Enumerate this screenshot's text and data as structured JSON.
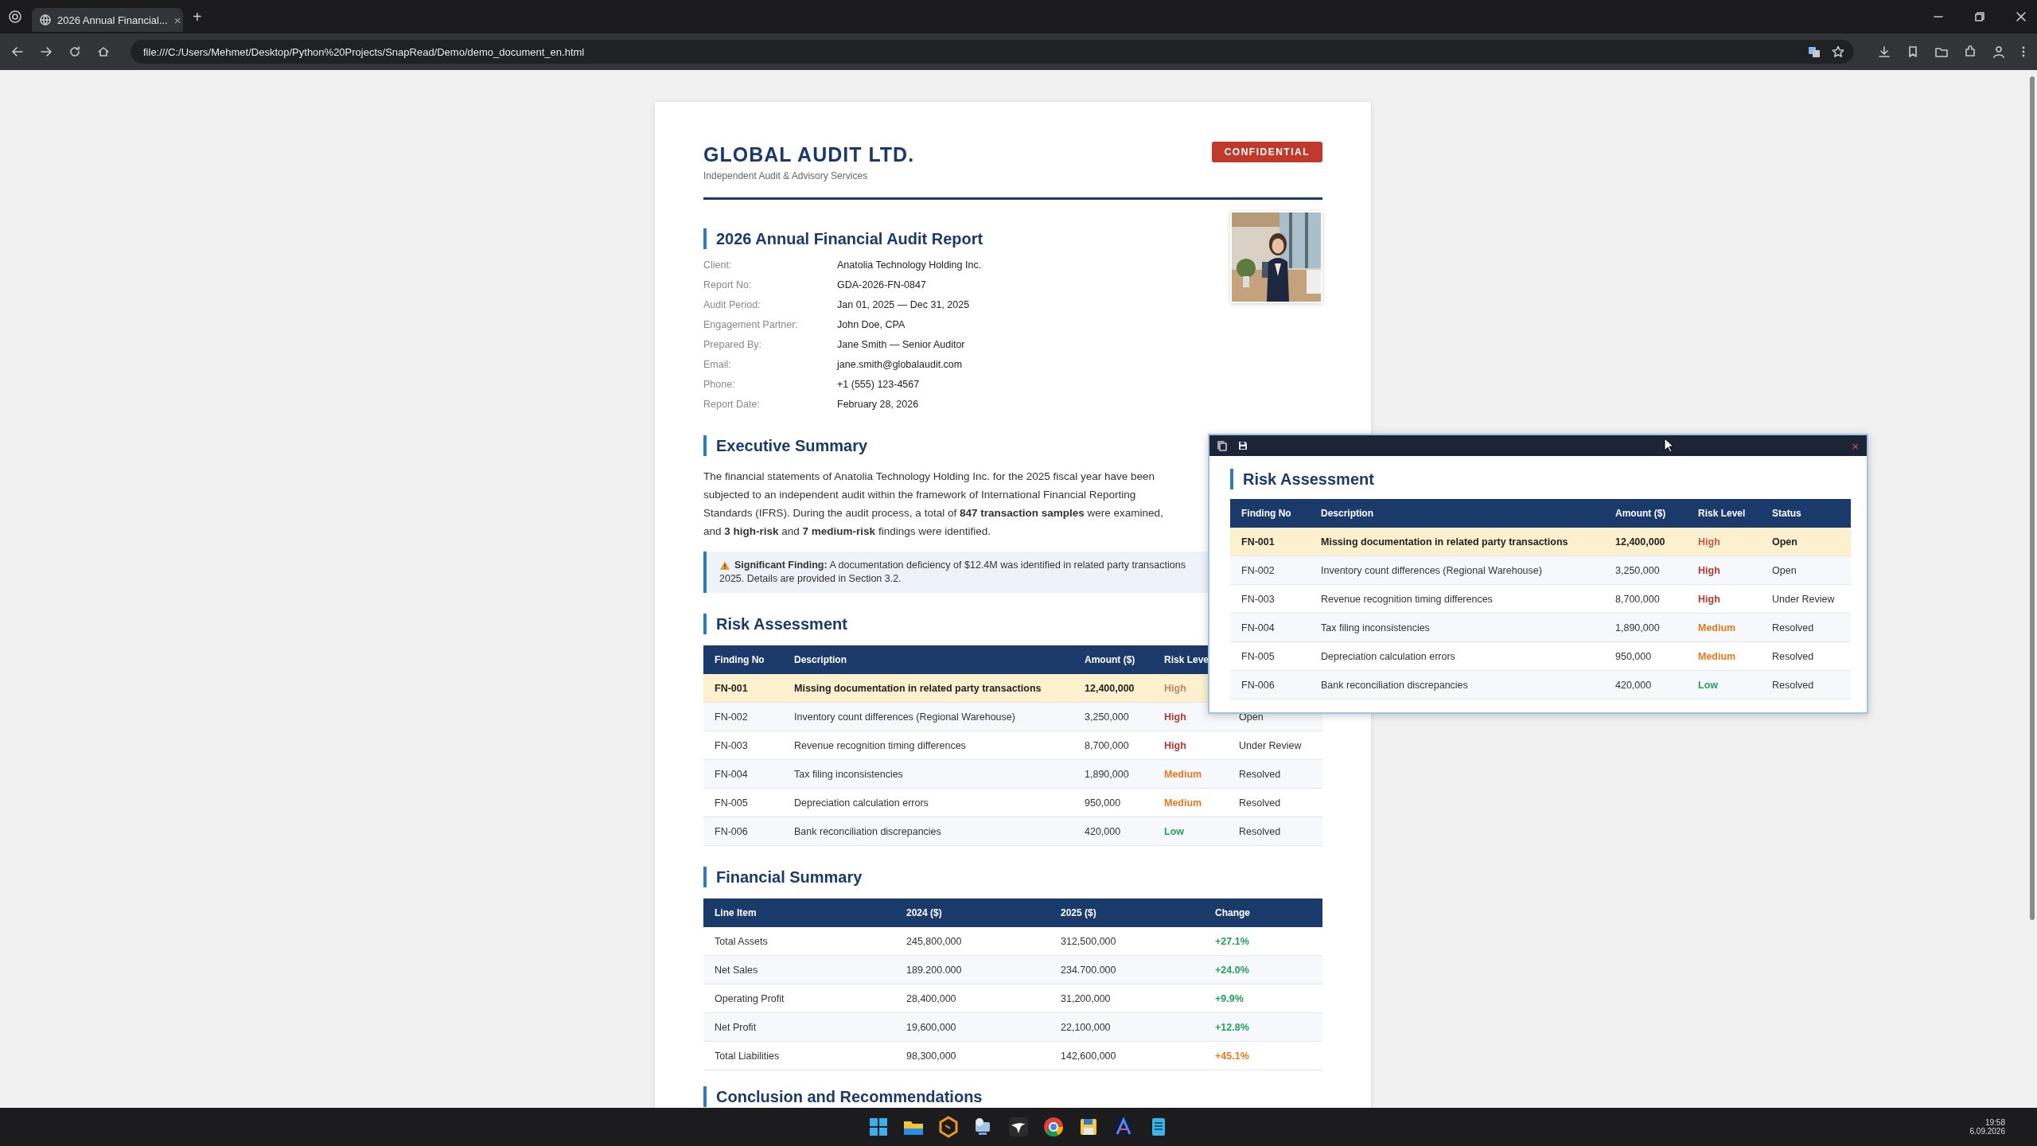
{
  "browser": {
    "tab_title": "2026 Annual Financial...",
    "new_tab": "+",
    "tab_close": "×",
    "url": "file:///C:/Users/Mehmet/Desktop/Python%20Projects/SnapRead/Demo/demo_document_en.html"
  },
  "document": {
    "company": "GLOBAL AUDIT LTD.",
    "tagline": "Independent Audit & Advisory Services",
    "badge": "CONFIDENTIAL",
    "title": "2026 Annual Financial Audit Report",
    "meta": [
      {
        "label": "Client:",
        "value": "Anatolia Technology Holding Inc."
      },
      {
        "label": "Report No:",
        "value": "GDA-2026-FN-0847"
      },
      {
        "label": "Audit Period:",
        "value": "Jan 01, 2025 — Dec 31, 2025"
      },
      {
        "label": "Engagement Partner:",
        "value": "John Doe, CPA"
      },
      {
        "label": "Prepared By:",
        "value": "Jane Smith — Senior Auditor"
      },
      {
        "label": "Email:",
        "value": "jane.smith@globalaudit.com"
      },
      {
        "label": "Phone:",
        "value": "+1 (555) 123-4567"
      },
      {
        "label": "Report Date:",
        "value": "February 28, 2026"
      }
    ],
    "executive_summary": {
      "heading": "Executive Summary",
      "paragraph": "The financial statements of Anatolia Technology Holding Inc. for the 2025 fiscal year have been subjected to an independent audit within the framework of International Financial Reporting Standards (IFRS). During the audit process, a total of **847 transaction samples** were examined, and **3 high-risk** and **7 medium-risk** findings were identified.",
      "callout_lines": [
        "**Significant Finding:** A documentation deficiency of $12.4M was identified in related party transactions",
        "2025. Details are provided in Section 3.2."
      ]
    },
    "risk_assessment": {
      "heading": "Risk Assessment",
      "columns": [
        "Finding No",
        "Description",
        "Amount ($)",
        "Risk Leve"
      ],
      "rows": [
        {
          "id": "FN-001",
          "description": "Missing documentation in related party transactions",
          "amount": "12,400,000",
          "risk": "High",
          "color": "#c0846a",
          "selected": true
        },
        {
          "id": "FN-002",
          "description": "Inventory count differences (Regional Warehouse)",
          "amount": "3,250,000",
          "risk": "High",
          "color": "#b03a2e",
          "selected": false,
          "status": "Open"
        },
        {
          "id": "FN-003",
          "description": "Revenue recognition timing differences",
          "amount": "8,700,000",
          "risk": "High",
          "color": "#b03a2e",
          "selected": false,
          "status": "Under Review"
        },
        {
          "id": "FN-004",
          "description": "Tax filing inconsistencies",
          "amount": "1,890,000",
          "risk": "Medium",
          "color": "#e07b20",
          "selected": false,
          "status": "Resolved"
        },
        {
          "id": "FN-005",
          "description": "Depreciation calculation errors",
          "amount": "950,000",
          "risk": "Medium",
          "color": "#e07b20",
          "selected": false,
          "status": "Resolved"
        },
        {
          "id": "FN-006",
          "description": "Bank reconciliation discrepancies",
          "amount": "420,000",
          "risk": "Low",
          "color": "#27a05a",
          "selected": false,
          "status": "Resolved"
        }
      ]
    },
    "financial_summary": {
      "heading": "Financial Summary",
      "columns": [
        "Line Item",
        "2024 ($)",
        "2025 ($)",
        "Change"
      ],
      "rows": [
        {
          "item": "Total Assets",
          "y2024": "245,800,000",
          "y2025": "312,500,000",
          "change": "+27.1%",
          "color": "#27a05a"
        },
        {
          "item": "Net Sales",
          "y2024": "189.200.000",
          "y2025": "234.700.000",
          "change": "+24.0%",
          "color": "#27a05a"
        },
        {
          "item": "Operating Profit",
          "y2024": "28,400,000",
          "y2025": "31,200,000",
          "change": "+9.9%",
          "color": "#27a05a"
        },
        {
          "item": "Net Profit",
          "y2024": "19,600,000",
          "y2025": "22,100,000",
          "change": "+12.8%",
          "color": "#27a05a"
        },
        {
          "item": "Total Liabilities",
          "y2024": "98,300,000",
          "y2025": "142,600,000",
          "change": "+45.1%",
          "color": "#e07b20"
        }
      ]
    },
    "conclusion": {
      "heading": "Conclusion and Recommendations"
    }
  },
  "popup": {
    "close": "×",
    "heading": "Risk Assessment",
    "columns": [
      "Finding No",
      "Description",
      "Amount ($)",
      "Risk Level",
      "Status"
    ],
    "rows": [
      {
        "id": "FN-001",
        "description": "Missing documentation in related party transactions",
        "amount": "12,400,000",
        "risk": "High",
        "color": "#c0584a",
        "selected": true,
        "status": "Open"
      },
      {
        "id": "FN-002",
        "description": "Inventory count differences (Regional Warehouse)",
        "amount": "3,250,000",
        "risk": "High",
        "color": "#b03a2e",
        "selected": false,
        "status": "Open"
      },
      {
        "id": "FN-003",
        "description": "Revenue recognition timing differences",
        "amount": "8,700,000",
        "risk": "High",
        "color": "#b03a2e",
        "selected": false,
        "status": "Under Review"
      },
      {
        "id": "FN-004",
        "description": "Tax filing inconsistencies",
        "amount": "1,890,000",
        "risk": "Medium",
        "color": "#e07b20",
        "selected": false,
        "status": "Resolved"
      },
      {
        "id": "FN-005",
        "description": "Depreciation calculation errors",
        "amount": "950,000",
        "risk": "Medium",
        "color": "#e07b20",
        "selected": false,
        "status": "Resolved"
      },
      {
        "id": "FN-006",
        "description": "Bank reconciliation discrepancies",
        "amount": "420,000",
        "risk": "Low",
        "color": "#27a05a",
        "selected": false,
        "status": "Resolved"
      }
    ]
  },
  "taskbar": {
    "time": "19:58",
    "date": "6.09.2026"
  }
}
